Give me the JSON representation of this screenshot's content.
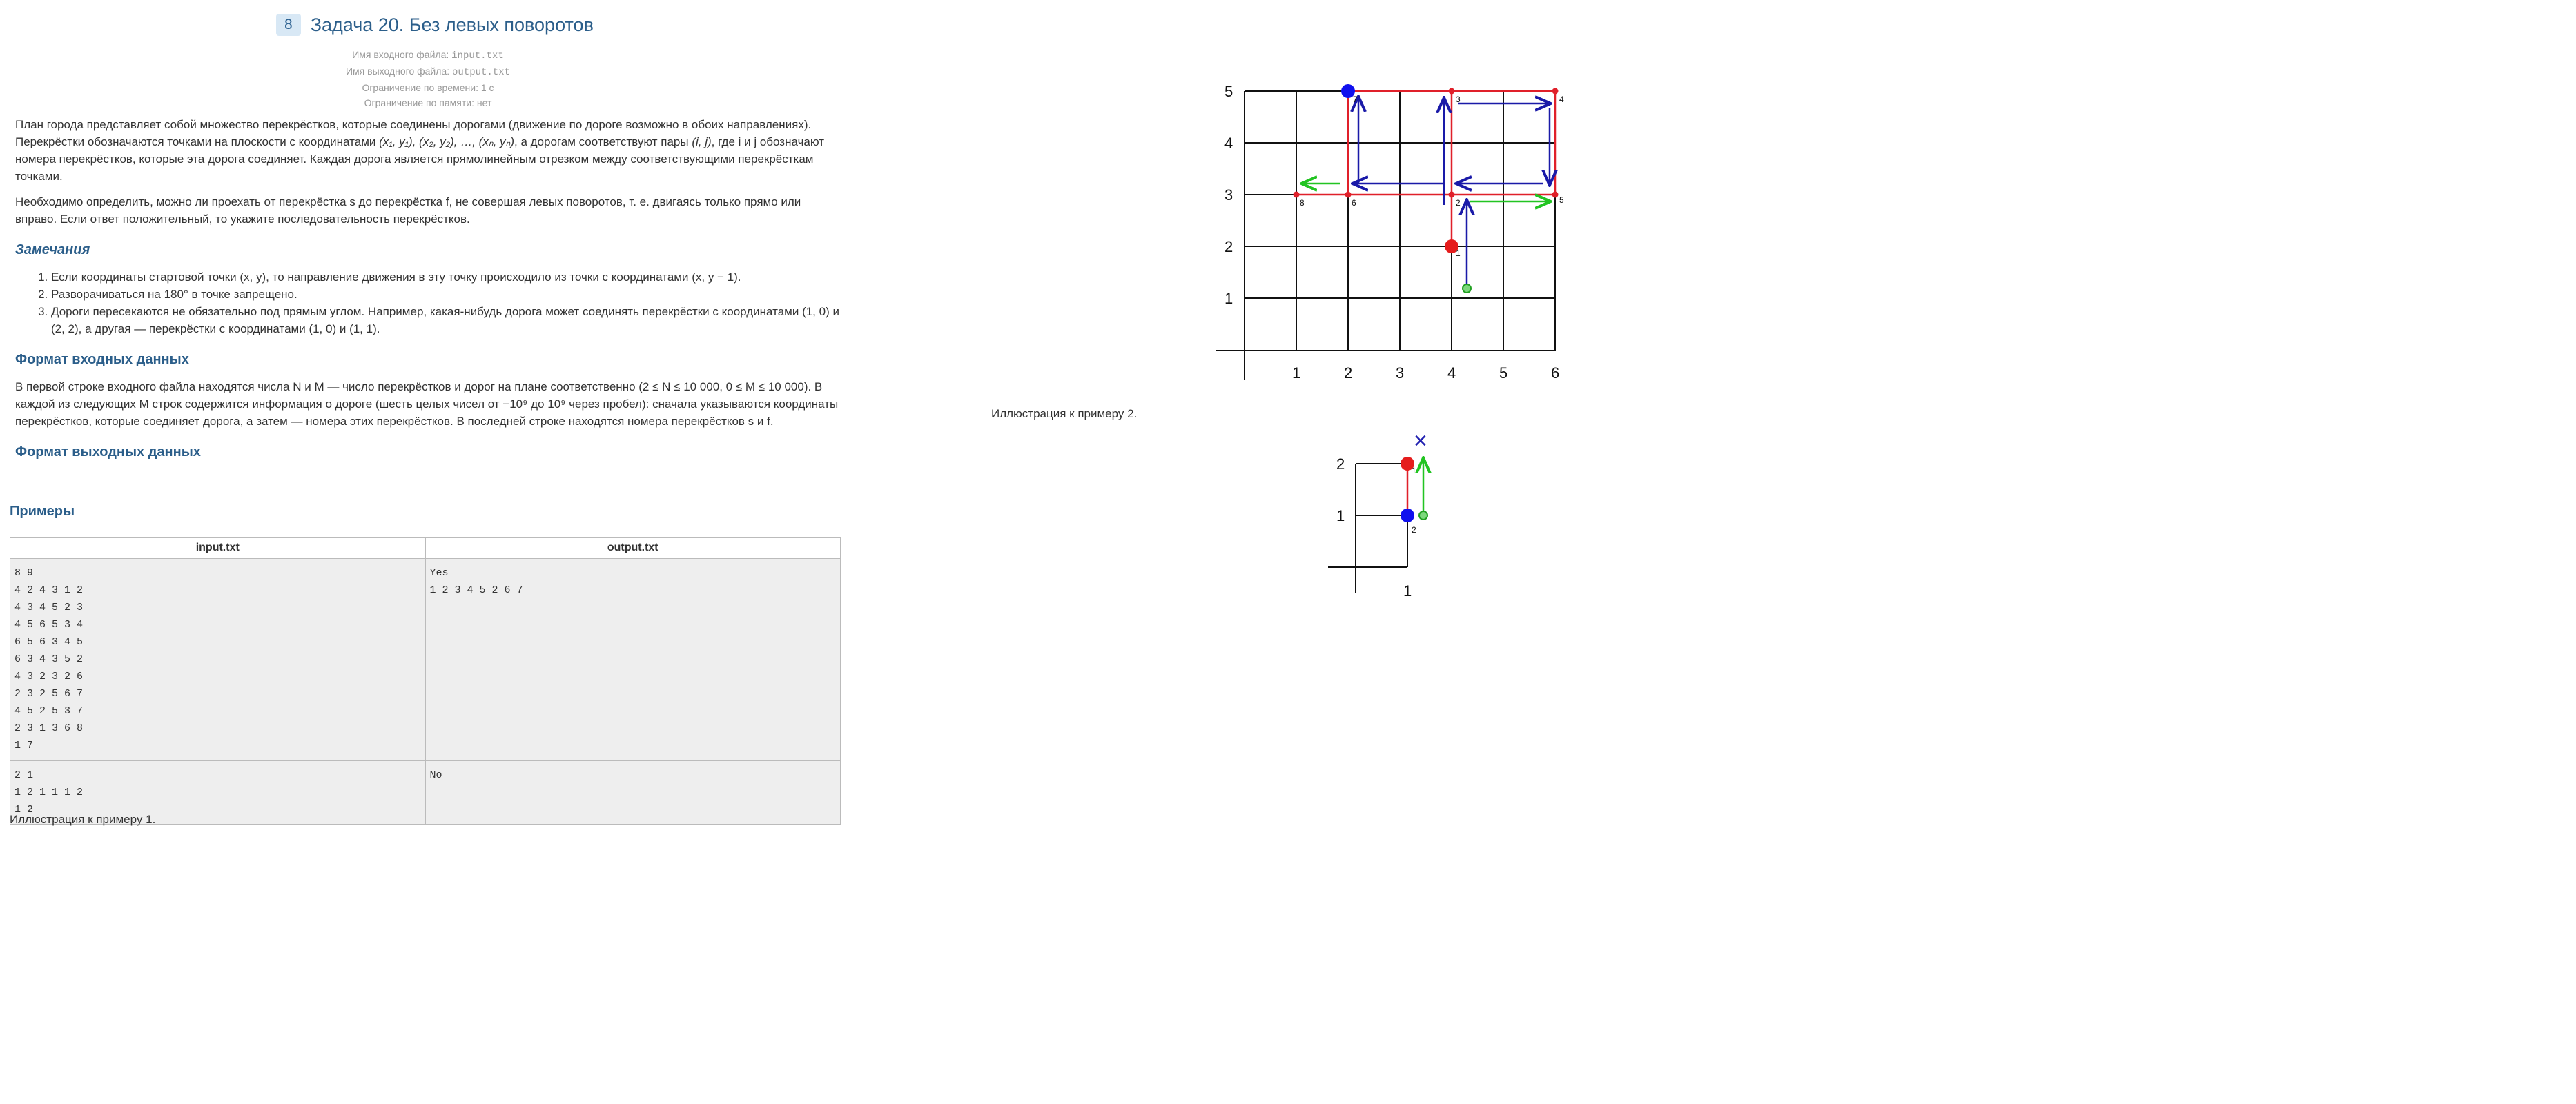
{
  "header": {
    "badge": "8",
    "title": "Задача 20. Без левых поворотов"
  },
  "limits": {
    "input_label": "Имя входного файла:",
    "input_file": "input.txt",
    "output_label": "Имя выходного файла:",
    "output_file": "output.txt",
    "time": "Ограничение по времени: 1 с",
    "memory": "Ограничение по памяти: нет"
  },
  "statement": {
    "p1a": "План города представляет собой множество перекрёстков, которые соединены дорогами (движение по дороге возможно в обоих направлениях). Перекрёстки обозначаются точками на плоскости с координатами ",
    "p1coords": "(x₁, y₁), (x₂, y₂), …, (xₙ, yₙ)",
    "p1b": ", а дорогам соответствуют пары ",
    "p1pair": "(i, j)",
    "p1c": ", где i и j обозначают номера перекрёстков, которые эта дорога соединяет. Каждая дорога является прямолинейным отрезком между соответствующими перекрёсткам точками.",
    "p2": "Необходимо определить, можно ли проехать от перекрёстка s до перекрёстка f, не совершая левых поворотов, т. е. двигаясь только прямо или вправо. Если ответ положительный, то укажите последовательность перекрёстков."
  },
  "notes": {
    "title": "Замечания",
    "items": [
      "Если координаты стартовой точки (x, y), то направление движения в эту точку происходило из точки с координатами (x, y − 1).",
      "Разворачиваться на 180° в точке запрещено.",
      "Дороги пересекаются не обязательно под прямым углом. Например, какая-нибудь дорога может соединять перекрёстки с координатами (1, 0) и (2, 2), а другая — перекрёстки с координатами (1, 0) и (1, 1)."
    ]
  },
  "input_format": {
    "title": "Формат входных данных",
    "text": "В первой строке входного файла находятся числа N и M — число перекрёстков и дорог на плане соответственно (2 ≤ N ≤ 10 000, 0 ≤ M ≤ 10 000). В каждой из следующих M строк содержится информация о дороге (шесть целых чисел от −10⁹ до 10⁹ через пробел): сначала указываются координаты перекрёстков, которые соединяет дорога, а затем — номера этих перекрёстков. В последней строке находятся номера перекрёстков s и f."
  },
  "output_format": {
    "title": "Формат выходных данных"
  },
  "examples": {
    "title": "Примеры",
    "col_in": "input.txt",
    "col_out": "output.txt",
    "rows": [
      {
        "input": "8 9\n4 2 4 3 1 2\n4 3 4 5 2 3\n4 5 6 5 3 4\n6 5 6 3 4 5\n6 3 4 3 5 2\n4 3 2 3 2 6\n2 3 2 5 6 7\n4 5 2 5 3 7\n2 3 1 3 6 8\n1 7",
        "output": "Yes\n1 2 3 4 5 2 6 7"
      },
      {
        "input": "2 1\n1 2 1 1 1 2\n1 2",
        "output": "No"
      }
    ]
  },
  "caption1": "Иллюстрация к примеру 1.",
  "caption2": "Иллюстрация к примеру 2.",
  "figure1": {
    "y_ticks": [
      "5",
      "4",
      "3",
      "2",
      "1"
    ],
    "x_ticks": [
      "1",
      "2",
      "3",
      "4",
      "5",
      "6"
    ],
    "node_labels": [
      "1",
      "2",
      "3",
      "4",
      "5",
      "6",
      "7",
      "8"
    ]
  },
  "figure2": {
    "y_ticks": [
      "2",
      "1"
    ],
    "x_ticks": [
      "1"
    ],
    "node_labels": [
      "1",
      "2"
    ],
    "cross": "×"
  },
  "colors": {
    "title": "#2b5e8a",
    "road": "#e0202a",
    "path_blue": "#1a1aa8",
    "path_green": "#22c422",
    "start": "#1010ee",
    "finish": "#e51c1c"
  }
}
